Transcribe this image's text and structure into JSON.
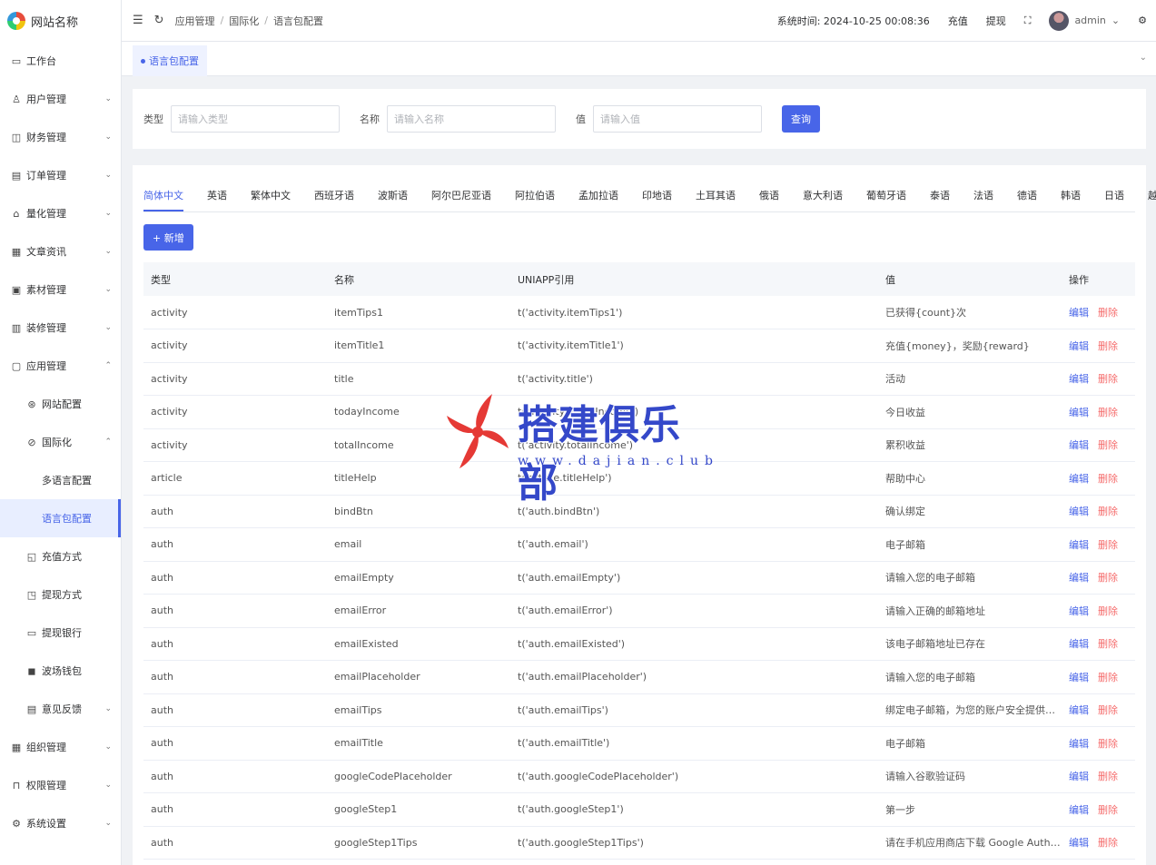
{
  "app": {
    "site_name": "网站名称"
  },
  "sidebar": {
    "items": [
      {
        "label": "工作台",
        "icon": "▭",
        "chev": ""
      },
      {
        "label": "用户管理",
        "icon": "♙",
        "chev": "⌄"
      },
      {
        "label": "财务管理",
        "icon": "◫",
        "chev": "⌄"
      },
      {
        "label": "订单管理",
        "icon": "▤",
        "chev": "⌄"
      },
      {
        "label": "量化管理",
        "icon": "⌂",
        "chev": "⌄"
      },
      {
        "label": "文章资讯",
        "icon": "▦",
        "chev": "⌄"
      },
      {
        "label": "素材管理",
        "icon": "▣",
        "chev": "⌄"
      },
      {
        "label": "装修管理",
        "icon": "▥",
        "chev": "⌄"
      },
      {
        "label": "应用管理",
        "icon": "▢",
        "chev": "⌃"
      },
      {
        "label": "网站配置",
        "icon": "⊛",
        "chev": ""
      },
      {
        "label": "国际化",
        "icon": "⊘",
        "chev": "⌃"
      },
      {
        "label": "多语言配置",
        "icon": "",
        "chev": ""
      },
      {
        "label": "语言包配置",
        "icon": "",
        "chev": ""
      },
      {
        "label": "充值方式",
        "icon": "◱",
        "chev": ""
      },
      {
        "label": "提现方式",
        "icon": "◳",
        "chev": ""
      },
      {
        "label": "提现银行",
        "icon": "▭",
        "chev": ""
      },
      {
        "label": "波场钱包",
        "icon": "◼",
        "chev": ""
      },
      {
        "label": "意见反馈",
        "icon": "▤",
        "chev": "⌄"
      },
      {
        "label": "组织管理",
        "icon": "▦",
        "chev": "⌄"
      },
      {
        "label": "权限管理",
        "icon": "⊓",
        "chev": "⌄"
      },
      {
        "label": "系统设置",
        "icon": "⚙",
        "chev": "⌄"
      }
    ]
  },
  "header": {
    "menu_icon": "☰",
    "refresh_icon": "↻",
    "breadcrumb": [
      "应用管理",
      "国际化",
      "语言包配置"
    ],
    "system_time_label": "系统时间: 2024-10-25 00:08:36",
    "recharge": "充值",
    "withdraw": "提现",
    "fullscreen_icon": "⛶",
    "username": "admin",
    "chev": "⌄",
    "settings_icon": "⚙"
  },
  "view_tab": {
    "label": "语言包配置",
    "chev": "⌄"
  },
  "filter": {
    "type_label": "类型",
    "type_placeholder": "请输入类型",
    "name_label": "名称",
    "name_placeholder": "请输入名称",
    "value_label": "值",
    "value_placeholder": "请输入值",
    "query": "查询"
  },
  "lang_tabs": [
    "简体中文",
    "英语",
    "繁体中文",
    "西班牙语",
    "波斯语",
    "阿尔巴尼亚语",
    "阿拉伯语",
    "孟加拉语",
    "印地语",
    "土耳其语",
    "俄语",
    "意大利语",
    "葡萄牙语",
    "泰语",
    "法语",
    "德语",
    "韩语",
    "日语",
    "越南语"
  ],
  "add_button": "+ 新增",
  "table": {
    "columns": [
      "类型",
      "名称",
      "UNIAPP引用",
      "值",
      "操作"
    ],
    "edit_label": "编辑",
    "delete_label": "删除",
    "rows": [
      [
        "activity",
        "itemTips1",
        "t('activity.itemTips1')",
        "已获得{count}次"
      ],
      [
        "activity",
        "itemTitle1",
        "t('activity.itemTitle1')",
        "充值{money}，奖励{reward}"
      ],
      [
        "activity",
        "title",
        "t('activity.title')",
        "活动"
      ],
      [
        "activity",
        "todayIncome",
        "t('activity.todayIncome')",
        "今日收益"
      ],
      [
        "activity",
        "totalIncome",
        "t('activity.totalIncome')",
        "累积收益"
      ],
      [
        "article",
        "titleHelp",
        "t('article.titleHelp')",
        "帮助中心"
      ],
      [
        "auth",
        "bindBtn",
        "t('auth.bindBtn')",
        "确认绑定"
      ],
      [
        "auth",
        "email",
        "t('auth.email')",
        "电子邮箱"
      ],
      [
        "auth",
        "emailEmpty",
        "t('auth.emailEmpty')",
        "请输入您的电子邮箱"
      ],
      [
        "auth",
        "emailError",
        "t('auth.emailError')",
        "请输入正确的邮箱地址"
      ],
      [
        "auth",
        "emailExisted",
        "t('auth.emailExisted')",
        "该电子邮箱地址已存在"
      ],
      [
        "auth",
        "emailPlaceholder",
        "t('auth.emailPlaceholder')",
        "请输入您的电子邮箱"
      ],
      [
        "auth",
        "emailTips",
        "t('auth.emailTips')",
        "绑定电子邮箱，为您的账户安全提供了另..."
      ],
      [
        "auth",
        "emailTitle",
        "t('auth.emailTitle')",
        "电子邮箱"
      ],
      [
        "auth",
        "googleCodePlaceholder",
        "t('auth.googleCodePlaceholder')",
        "请输入谷歌验证码"
      ],
      [
        "auth",
        "googleStep1",
        "t('auth.googleStep1')",
        "第一步"
      ],
      [
        "auth",
        "googleStep1Tips",
        "t('auth.googleStep1Tips')",
        "请在手机应用商店下载 Google Authentica..."
      ]
    ]
  },
  "watermark": {
    "text": "搭建俱乐部",
    "url": "www.dajian.club"
  },
  "colors": {
    "primary": "#4865e8",
    "danger": "#f56c6c"
  }
}
